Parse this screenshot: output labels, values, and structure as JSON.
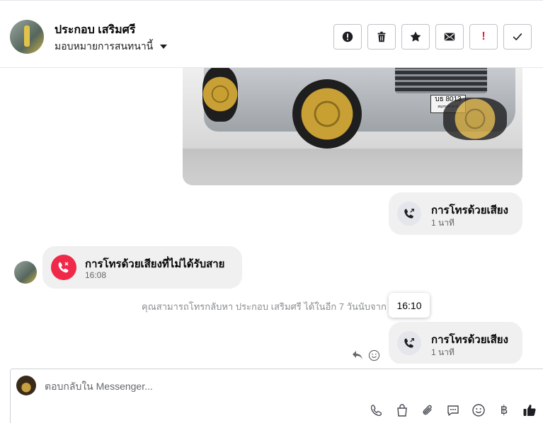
{
  "header": {
    "contact_name": "ประกอบ เสริมศรี",
    "assign_label": "มอบหมายการสนทนานี้",
    "toolbar": [
      {
        "icon": "exclamation-circle-icon"
      },
      {
        "icon": "trash-icon"
      },
      {
        "icon": "star-icon"
      },
      {
        "icon": "envelope-icon"
      },
      {
        "icon": "red-exclamation-icon",
        "text": "!"
      },
      {
        "icon": "check-icon"
      }
    ]
  },
  "thread": {
    "photo": {
      "plate_line1": "บธ 8013",
      "plate_line2": "สมุทรปราการ"
    },
    "outgoing_call_1": {
      "title": "การโทรด้วยเสียง",
      "duration": "1 นาที"
    },
    "missed_call": {
      "title": "การโทรด้วยเสียงที่ไม่ได้รับสาย",
      "time": "16:08"
    },
    "system_note": "คุณสามารถโทรกลับหา ประกอบ เสริมศรี ได้ในอีก 7 วันนับจาก",
    "tooltip_time": "16:10",
    "outgoing_call_2": {
      "title": "การโทรด้วยเสียง",
      "duration": "1 นาที"
    }
  },
  "composer": {
    "placeholder": "ตอบกลับใน Messenger...",
    "baht_symbol": "฿"
  },
  "colors": {
    "missed_call": "#f02849",
    "like_blue": "#1877f2",
    "bubble_bg": "#f0f0f0"
  }
}
